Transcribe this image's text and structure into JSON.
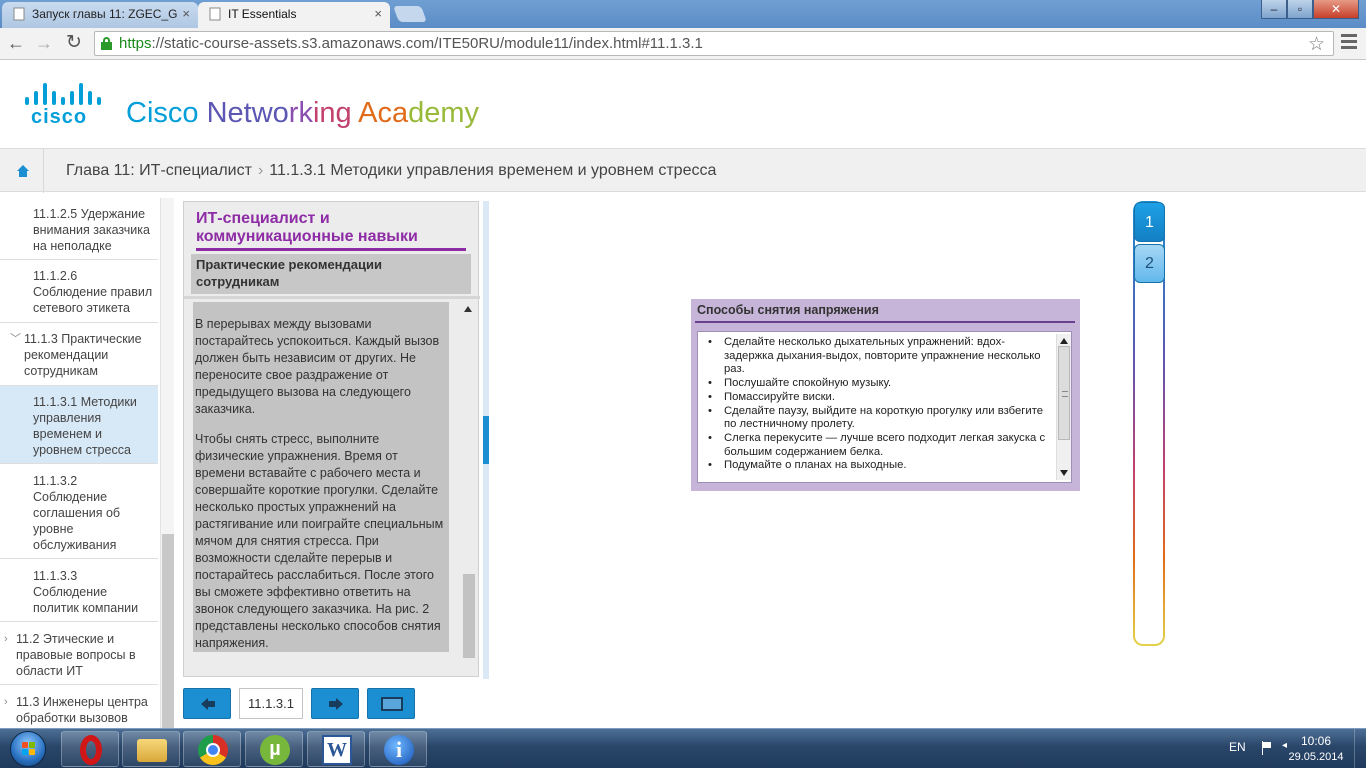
{
  "browser": {
    "tabs": [
      {
        "title": "Запуск главы 11: ZGEC_G"
      },
      {
        "title": "IT Essentials"
      }
    ],
    "url_scheme": "https",
    "url_rest": "://static-course-assets.s3.amazonaws.com/ITE50RU/module11/index.html#11.1.3.1"
  },
  "header": {
    "logo_word": "cisco",
    "academy_parts": [
      "Cisco ",
      "Netwo",
      "rk",
      "ing",
      " Aca",
      "demy"
    ]
  },
  "breadcrumb": {
    "chapter": "Глава 11: ИТ-специалист",
    "separator": "›",
    "topic": "11.1.3.1 Методики управления временем и уровнем стресса"
  },
  "sidebar": {
    "items": [
      {
        "label": "11.1.2.5 Удержание внимания заказчика на неполадке"
      },
      {
        "label": "11.1.2.6 Соблюдение правил сетевого этикета"
      },
      {
        "label": "11.1.3 Практические рекомендации сотрудникам"
      },
      {
        "label": "11.1.3.1 Методики управления временем и уровнем стресса"
      },
      {
        "label": "11.1.3.2 Соблюдение соглашения об уровне обслуживания"
      },
      {
        "label": "11.1.3.3 Соблюдение политик компании"
      },
      {
        "label": "11.2 Этические и правовые вопросы в области ИТ"
      },
      {
        "label": "11.3 Инженеры центра обработки вызовов"
      }
    ]
  },
  "panel": {
    "title": "ИТ-специалист и коммуникационные навыки",
    "subtitle": "Практические рекомендации сотрудникам",
    "paragraph1": "В перерывах между вызовами постарайтесь успокоиться. Каждый вызов должен быть независим от других. Не переносите свое раздражение от предыдущего вызова на следующего заказчика.",
    "paragraph2": "Чтобы снять стресс, выполните физические упражнения. Время от времени вставайте с рабочего места и совершайте короткие прогулки. Сделайте несколько простых упражнений на растягивание или поиграйте специальным мячом для снятия стресса. При возможности сделайте перерыв и постарайтесь расслабиться. После этого вы сможете эффективно ответить на звонок следующего заказчика. На рис. 2 представлены несколько способов снятия напряжения."
  },
  "nav": {
    "page_number": "11.1.3.1"
  },
  "figure": {
    "box_title": "Способы снятия напряжения",
    "items": [
      "Сделайте несколько дыхательных упражнений: вдох-задержка дыхания-выдох, повторите упражнение несколько раз.",
      "Послушайте спокойную музыку.",
      "Помассируйте виски.",
      "Сделайте паузу, выйдите на короткую прогулку или взбегите по лестничному пролету.",
      "Слегка перекусите — лучше всего подходит легкая закуска с большим содержанием белка.",
      "Подумайте о планах на выходные."
    ],
    "tabs": [
      "1",
      "2"
    ],
    "active_tab": "1"
  },
  "taskbar": {
    "apps": [
      "opera",
      "explorer",
      "chrome",
      "utorrent",
      "word",
      "info"
    ],
    "word_letter": "W",
    "info_letter": "i",
    "utorrent_letter": "µ",
    "language": "EN",
    "time": "10:06",
    "date": "29.05.2014"
  },
  "colors": {
    "cisco_blue": "#049fd9",
    "accent_purple": "#8e2ca6",
    "nav_blue": "#1b8fd2",
    "figure_box": "#c7b5d9"
  }
}
